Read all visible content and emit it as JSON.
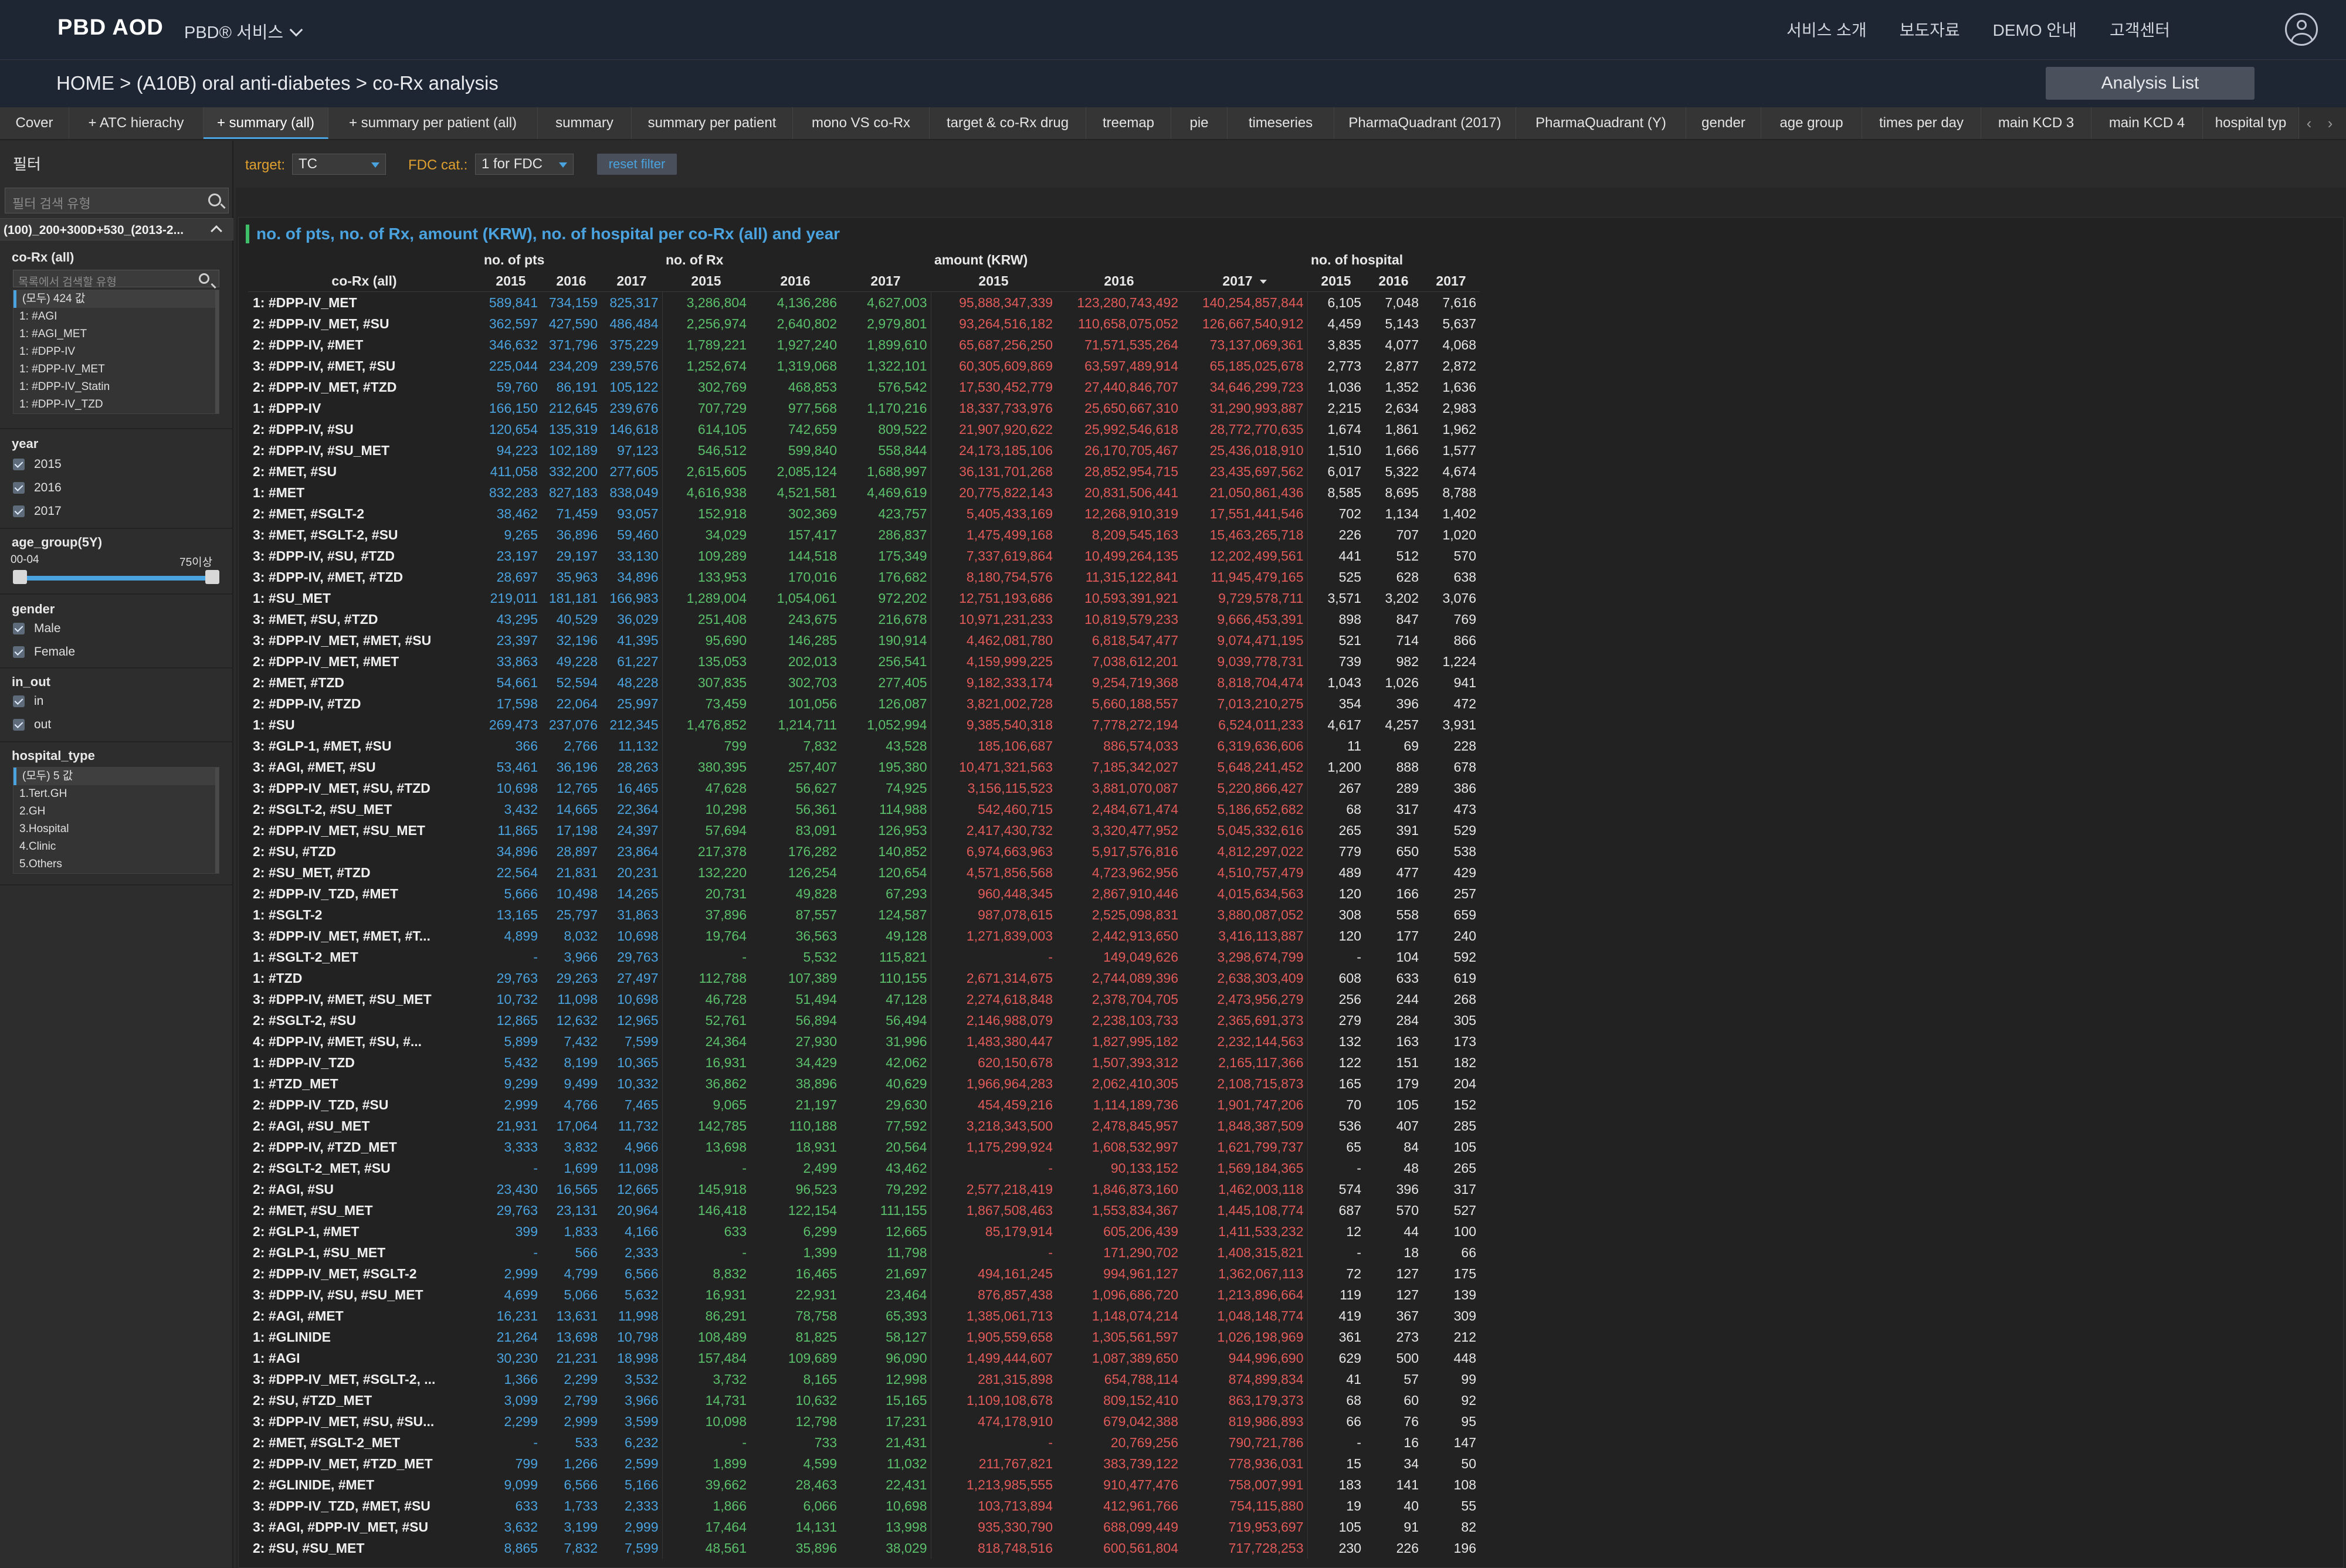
{
  "header": {
    "logo": "PBD AOD",
    "service_menu": "PBD® 서비스",
    "nav": [
      "서비스 소개",
      "보도자료",
      "DEMO 안내",
      "고객센터"
    ]
  },
  "breadcrumb": "HOME > (A10B) oral anti-diabetes > co-Rx analysis",
  "analysis_list_label": "Analysis List",
  "tabs": [
    "Cover",
    "+ ATC hierachy",
    "+ summary (all)",
    "+ summary per patient (all)",
    "summary",
    "summary per patient",
    "mono VS co-Rx",
    "target & co-Rx drug",
    "treemap",
    "pie",
    "timeseries",
    "PharmaQuadrant (2017)",
    "PharmaQuadrant (Y)",
    "gender",
    "age group",
    "times per day",
    "main KCD 3",
    "main KCD 4",
    "hospital typ"
  ],
  "active_tab": "+ summary (all)",
  "sidebar": {
    "title": "필터",
    "search_placeholder": "필터 검색 유형",
    "selection": "(100)_200+300D+530_(2013-2...",
    "corx": {
      "title": "co-Rx (all)",
      "search_placeholder": "목록에서 검색할 유형",
      "items": [
        "(모두) 424 값",
        "1: #AGI",
        "1: #AGI_MET",
        "1: #DPP-IV",
        "1: #DPP-IV_MET",
        "1: #DPP-IV_Statin",
        "1: #DPP-IV_TZD"
      ]
    },
    "year": {
      "title": "year",
      "items": [
        "2015",
        "2016",
        "2017"
      ]
    },
    "age_group": {
      "title": "age_group(5Y)",
      "min_label": "00-04",
      "max_label": "75이상"
    },
    "gender": {
      "title": "gender",
      "items": [
        "Male",
        "Female"
      ]
    },
    "in_out": {
      "title": "in_out",
      "items": [
        "in",
        "out"
      ]
    },
    "hospital_type": {
      "title": "hospital_type",
      "items": [
        "(모두) 5 값",
        "1.Tert.GH",
        "2.GH",
        "3.Hospital",
        "4.Clinic",
        "5.Others"
      ]
    }
  },
  "filters": {
    "target_label": "target:",
    "target_value": "TC",
    "fdc_label": "FDC cat.:",
    "fdc_value": "1 for FDC",
    "reset_label": "reset filter"
  },
  "panel_title": "no. of pts, no. of Rx, amount (KRW), no. of hospital per co-Rx (all) and year",
  "table": {
    "group_headers": [
      "no. of pts",
      "no. of Rx",
      "amount (KRW)",
      "no. of hospital"
    ],
    "row_header": "co-Rx (all)",
    "years": [
      "2015",
      "2016",
      "2017"
    ],
    "rows": [
      [
        "1: #DPP-IV_MET",
        "589,841",
        "734,159",
        "825,317",
        "3,286,804",
        "4,136,286",
        "4,627,003",
        "95,888,347,339",
        "123,280,743,492",
        "140,254,857,844",
        "6,105",
        "7,048",
        "7,616"
      ],
      [
        "2: #DPP-IV_MET, #SU",
        "362,597",
        "427,590",
        "486,484",
        "2,256,974",
        "2,640,802",
        "2,979,801",
        "93,264,516,182",
        "110,658,075,052",
        "126,667,540,912",
        "4,459",
        "5,143",
        "5,637"
      ],
      [
        "2: #DPP-IV, #MET",
        "346,632",
        "371,796",
        "375,229",
        "1,789,221",
        "1,927,240",
        "1,899,610",
        "65,687,256,250",
        "71,571,535,264",
        "73,137,069,361",
        "3,835",
        "4,077",
        "4,068"
      ],
      [
        "3: #DPP-IV, #MET, #SU",
        "225,044",
        "234,209",
        "239,576",
        "1,252,674",
        "1,319,068",
        "1,322,101",
        "60,305,609,869",
        "63,597,489,914",
        "65,185,025,678",
        "2,773",
        "2,877",
        "2,872"
      ],
      [
        "2: #DPP-IV_MET, #TZD",
        "59,760",
        "86,191",
        "105,122",
        "302,769",
        "468,853",
        "576,542",
        "17,530,452,779",
        "27,440,846,707",
        "34,646,299,723",
        "1,036",
        "1,352",
        "1,636"
      ],
      [
        "1: #DPP-IV",
        "166,150",
        "212,645",
        "239,676",
        "707,729",
        "977,568",
        "1,170,216",
        "18,337,733,976",
        "25,650,667,310",
        "31,290,993,887",
        "2,215",
        "2,634",
        "2,983"
      ],
      [
        "2: #DPP-IV, #SU",
        "120,654",
        "135,319",
        "146,618",
        "614,105",
        "742,659",
        "809,522",
        "21,907,920,622",
        "25,992,546,618",
        "28,772,770,635",
        "1,674",
        "1,861",
        "1,962"
      ],
      [
        "2: #DPP-IV, #SU_MET",
        "94,223",
        "102,189",
        "97,123",
        "546,512",
        "599,840",
        "558,844",
        "24,173,185,106",
        "26,170,705,467",
        "25,436,018,910",
        "1,510",
        "1,666",
        "1,577"
      ],
      [
        "2: #MET, #SU",
        "411,058",
        "332,200",
        "277,605",
        "2,615,605",
        "2,085,124",
        "1,688,997",
        "36,131,701,268",
        "28,852,954,715",
        "23,435,697,562",
        "6,017",
        "5,322",
        "4,674"
      ],
      [
        "1: #MET",
        "832,283",
        "827,183",
        "838,049",
        "4,616,938",
        "4,521,581",
        "4,469,619",
        "20,775,822,143",
        "20,831,506,441",
        "21,050,861,436",
        "8,585",
        "8,695",
        "8,788"
      ],
      [
        "2: #MET, #SGLT-2",
        "38,462",
        "71,459",
        "93,057",
        "152,918",
        "302,369",
        "423,757",
        "5,405,433,169",
        "12,268,910,319",
        "17,551,441,546",
        "702",
        "1,134",
        "1,402"
      ],
      [
        "3: #MET, #SGLT-2, #SU",
        "9,265",
        "36,896",
        "59,460",
        "34,029",
        "157,417",
        "286,837",
        "1,475,499,168",
        "8,209,545,163",
        "15,463,265,718",
        "226",
        "707",
        "1,020"
      ],
      [
        "3: #DPP-IV, #SU, #TZD",
        "23,197",
        "29,197",
        "33,130",
        "109,289",
        "144,518",
        "175,349",
        "7,337,619,864",
        "10,499,264,135",
        "12,202,499,561",
        "441",
        "512",
        "570"
      ],
      [
        "3: #DPP-IV, #MET, #TZD",
        "28,697",
        "35,963",
        "34,896",
        "133,953",
        "170,016",
        "176,682",
        "8,180,754,576",
        "11,315,122,841",
        "11,945,479,165",
        "525",
        "628",
        "638"
      ],
      [
        "1: #SU_MET",
        "219,011",
        "181,181",
        "166,983",
        "1,289,004",
        "1,054,061",
        "972,202",
        "12,751,193,686",
        "10,593,391,921",
        "9,729,578,711",
        "3,571",
        "3,202",
        "3,076"
      ],
      [
        "3: #MET, #SU, #TZD",
        "43,295",
        "40,529",
        "36,029",
        "251,408",
        "243,675",
        "216,678",
        "10,971,231,233",
        "10,819,579,233",
        "9,666,453,391",
        "898",
        "847",
        "769"
      ],
      [
        "3: #DPP-IV_MET, #MET, #SU",
        "23,397",
        "32,196",
        "41,395",
        "95,690",
        "146,285",
        "190,914",
        "4,462,081,780",
        "6,818,547,477",
        "9,074,471,195",
        "521",
        "714",
        "866"
      ],
      [
        "2: #DPP-IV_MET, #MET",
        "33,863",
        "49,228",
        "61,227",
        "135,053",
        "202,013",
        "256,541",
        "4,159,999,225",
        "7,038,612,201",
        "9,039,778,731",
        "739",
        "982",
        "1,224"
      ],
      [
        "2: #MET, #TZD",
        "54,661",
        "52,594",
        "48,228",
        "307,835",
        "302,703",
        "277,405",
        "9,182,333,174",
        "9,254,719,368",
        "8,818,704,474",
        "1,043",
        "1,026",
        "941"
      ],
      [
        "2: #DPP-IV, #TZD",
        "17,598",
        "22,064",
        "25,997",
        "73,459",
        "101,056",
        "126,087",
        "3,821,002,728",
        "5,660,188,557",
        "7,013,210,275",
        "354",
        "396",
        "472"
      ],
      [
        "1: #SU",
        "269,473",
        "237,076",
        "212,345",
        "1,476,852",
        "1,214,711",
        "1,052,994",
        "9,385,540,318",
        "7,778,272,194",
        "6,524,011,233",
        "4,617",
        "4,257",
        "3,931"
      ],
      [
        "3: #GLP-1, #MET, #SU",
        "366",
        "2,766",
        "11,132",
        "799",
        "7,832",
        "43,528",
        "185,106,687",
        "886,574,033",
        "6,319,636,606",
        "11",
        "69",
        "228"
      ],
      [
        "3: #AGI, #MET, #SU",
        "53,461",
        "36,196",
        "28,263",
        "380,395",
        "257,407",
        "195,380",
        "10,471,321,563",
        "7,185,342,027",
        "5,648,241,452",
        "1,200",
        "888",
        "678"
      ],
      [
        "3: #DPP-IV_MET, #SU, #TZD",
        "10,698",
        "12,765",
        "16,465",
        "47,628",
        "56,627",
        "74,925",
        "3,156,115,523",
        "3,881,070,087",
        "5,220,866,427",
        "267",
        "289",
        "386"
      ],
      [
        "2: #SGLT-2, #SU_MET",
        "3,432",
        "14,665",
        "22,364",
        "10,298",
        "56,361",
        "114,988",
        "542,460,715",
        "2,484,671,474",
        "5,186,652,682",
        "68",
        "317",
        "473"
      ],
      [
        "2: #DPP-IV_MET, #SU_MET",
        "11,865",
        "17,198",
        "24,397",
        "57,694",
        "83,091",
        "126,953",
        "2,417,430,732",
        "3,320,477,952",
        "5,045,332,616",
        "265",
        "391",
        "529"
      ],
      [
        "2: #SU, #TZD",
        "34,896",
        "28,897",
        "23,864",
        "217,378",
        "176,282",
        "140,852",
        "6,974,663,963",
        "5,917,576,816",
        "4,812,297,022",
        "779",
        "650",
        "538"
      ],
      [
        "2: #SU_MET, #TZD",
        "22,564",
        "21,831",
        "20,231",
        "132,220",
        "126,254",
        "120,654",
        "4,571,856,568",
        "4,723,962,956",
        "4,510,757,479",
        "489",
        "477",
        "429"
      ],
      [
        "2: #DPP-IV_TZD, #MET",
        "5,666",
        "10,498",
        "14,265",
        "20,731",
        "49,828",
        "67,293",
        "960,448,345",
        "2,867,910,446",
        "4,015,634,563",
        "120",
        "166",
        "257"
      ],
      [
        "1: #SGLT-2",
        "13,165",
        "25,797",
        "31,863",
        "37,896",
        "87,557",
        "124,587",
        "987,078,615",
        "2,525,098,831",
        "3,880,087,052",
        "308",
        "558",
        "659"
      ],
      [
        "3: #DPP-IV_MET, #MET, #T...",
        "4,899",
        "8,032",
        "10,698",
        "19,764",
        "36,563",
        "49,128",
        "1,271,839,003",
        "2,442,913,650",
        "3,416,113,887",
        "120",
        "177",
        "240"
      ],
      [
        "1: #SGLT-2_MET",
        "-",
        "3,966",
        "29,763",
        "-",
        "5,532",
        "115,821",
        "-",
        "149,049,626",
        "3,298,674,799",
        "-",
        "104",
        "592"
      ],
      [
        "1: #TZD",
        "29,763",
        "29,263",
        "27,497",
        "112,788",
        "107,389",
        "110,155",
        "2,671,314,675",
        "2,744,089,396",
        "2,638,303,409",
        "608",
        "633",
        "619"
      ],
      [
        "3: #DPP-IV, #MET, #SU_MET",
        "10,732",
        "11,098",
        "10,698",
        "46,728",
        "51,494",
        "47,128",
        "2,274,618,848",
        "2,378,704,705",
        "2,473,956,279",
        "256",
        "244",
        "268"
      ],
      [
        "2: #SGLT-2, #SU",
        "12,865",
        "12,632",
        "12,965",
        "52,761",
        "56,894",
        "56,494",
        "2,146,988,079",
        "2,238,103,733",
        "2,365,691,373",
        "279",
        "284",
        "305"
      ],
      [
        "4: #DPP-IV, #MET, #SU, #...",
        "5,899",
        "7,432",
        "7,599",
        "24,364",
        "27,930",
        "31,996",
        "1,483,380,447",
        "1,827,995,182",
        "2,232,144,563",
        "132",
        "163",
        "173"
      ],
      [
        "1: #DPP-IV_TZD",
        "5,432",
        "8,199",
        "10,365",
        "16,931",
        "34,429",
        "42,062",
        "620,150,678",
        "1,507,393,312",
        "2,165,117,366",
        "122",
        "151",
        "182"
      ],
      [
        "1: #TZD_MET",
        "9,299",
        "9,499",
        "10,332",
        "36,862",
        "38,896",
        "40,629",
        "1,966,964,283",
        "2,062,410,305",
        "2,108,715,873",
        "165",
        "179",
        "204"
      ],
      [
        "2: #DPP-IV_TZD, #SU",
        "2,999",
        "4,766",
        "7,465",
        "9,065",
        "21,197",
        "29,630",
        "454,459,216",
        "1,114,189,736",
        "1,901,747,206",
        "70",
        "105",
        "152"
      ],
      [
        "2: #AGI, #SU_MET",
        "21,931",
        "17,064",
        "11,732",
        "142,785",
        "110,188",
        "77,592",
        "3,218,343,500",
        "2,478,845,957",
        "1,848,387,509",
        "536",
        "407",
        "285"
      ],
      [
        "2: #DPP-IV, #TZD_MET",
        "3,333",
        "3,832",
        "4,966",
        "13,698",
        "18,931",
        "20,564",
        "1,175,299,924",
        "1,608,532,997",
        "1,621,799,737",
        "65",
        "84",
        "105"
      ],
      [
        "2: #SGLT-2_MET, #SU",
        "-",
        "1,699",
        "11,098",
        "-",
        "2,499",
        "43,462",
        "-",
        "90,133,152",
        "1,569,184,365",
        "-",
        "48",
        "265"
      ],
      [
        "2: #AGI, #SU",
        "23,430",
        "16,565",
        "12,665",
        "145,918",
        "96,523",
        "79,292",
        "2,577,218,419",
        "1,846,873,160",
        "1,462,003,118",
        "574",
        "396",
        "317"
      ],
      [
        "2: #MET, #SU_MET",
        "29,763",
        "23,131",
        "20,964",
        "146,418",
        "122,154",
        "111,155",
        "1,867,508,463",
        "1,553,834,367",
        "1,445,108,774",
        "687",
        "570",
        "527"
      ],
      [
        "2: #GLP-1, #MET",
        "399",
        "1,833",
        "4,166",
        "633",
        "6,299",
        "12,665",
        "85,179,914",
        "605,206,439",
        "1,411,533,232",
        "12",
        "44",
        "100"
      ],
      [
        "2: #GLP-1, #SU_MET",
        "-",
        "566",
        "2,333",
        "-",
        "1,399",
        "11,798",
        "-",
        "171,290,702",
        "1,408,315,821",
        "-",
        "18",
        "66"
      ],
      [
        "2: #DPP-IV_MET, #SGLT-2",
        "2,999",
        "4,799",
        "6,566",
        "8,832",
        "16,465",
        "21,697",
        "494,161,245",
        "994,961,127",
        "1,362,067,113",
        "72",
        "127",
        "175"
      ],
      [
        "3: #DPP-IV, #SU, #SU_MET",
        "4,699",
        "5,066",
        "5,632",
        "16,931",
        "22,931",
        "23,464",
        "876,857,438",
        "1,096,686,720",
        "1,213,896,664",
        "119",
        "127",
        "139"
      ],
      [
        "2: #AGI, #MET",
        "16,231",
        "13,631",
        "11,998",
        "86,291",
        "78,758",
        "65,393",
        "1,385,061,713",
        "1,148,074,214",
        "1,048,148,774",
        "419",
        "367",
        "309"
      ],
      [
        "1: #GLINIDE",
        "21,264",
        "13,698",
        "10,798",
        "108,489",
        "81,825",
        "58,127",
        "1,905,559,658",
        "1,305,561,597",
        "1,026,198,969",
        "361",
        "273",
        "212"
      ],
      [
        "1: #AGI",
        "30,230",
        "21,231",
        "18,998",
        "157,484",
        "109,689",
        "96,090",
        "1,499,444,607",
        "1,087,389,650",
        "944,996,690",
        "629",
        "500",
        "448"
      ],
      [
        "3: #DPP-IV_MET, #SGLT-2, ...",
        "1,366",
        "2,299",
        "3,532",
        "3,732",
        "8,165",
        "12,998",
        "281,315,898",
        "654,788,114",
        "874,899,834",
        "41",
        "57",
        "99"
      ],
      [
        "2: #SU, #TZD_MET",
        "3,099",
        "2,799",
        "3,966",
        "14,731",
        "10,632",
        "15,165",
        "1,109,108,678",
        "809,152,410",
        "863,179,373",
        "68",
        "60",
        "92"
      ],
      [
        "3: #DPP-IV_MET, #SU, #SU...",
        "2,299",
        "2,999",
        "3,599",
        "10,098",
        "12,798",
        "17,231",
        "474,178,910",
        "679,042,388",
        "819,986,893",
        "66",
        "76",
        "95"
      ],
      [
        "2: #MET, #SGLT-2_MET",
        "-",
        "533",
        "6,232",
        "-",
        "733",
        "21,431",
        "-",
        "20,769,256",
        "790,721,786",
        "-",
        "16",
        "147"
      ],
      [
        "2: #DPP-IV_MET, #TZD_MET",
        "799",
        "1,266",
        "2,599",
        "1,899",
        "4,599",
        "11,032",
        "211,767,821",
        "383,739,122",
        "778,936,031",
        "15",
        "34",
        "50"
      ],
      [
        "2: #GLINIDE, #MET",
        "9,099",
        "6,566",
        "5,166",
        "39,662",
        "28,463",
        "22,431",
        "1,213,985,555",
        "910,477,476",
        "758,007,991",
        "183",
        "141",
        "108"
      ],
      [
        "3: #DPP-IV_TZD, #MET, #SU",
        "633",
        "1,733",
        "2,333",
        "1,866",
        "6,066",
        "10,698",
        "103,713,894",
        "412,961,766",
        "754,115,880",
        "19",
        "40",
        "55"
      ],
      [
        "3: #AGI, #DPP-IV_MET, #SU",
        "3,632",
        "3,199",
        "2,999",
        "17,464",
        "14,131",
        "13,998",
        "935,330,790",
        "688,099,449",
        "719,953,697",
        "105",
        "91",
        "82"
      ],
      [
        "2: #SU, #SU_MET",
        "8,865",
        "7,832",
        "7,599",
        "48,561",
        "35,896",
        "38,029",
        "818,748,516",
        "600,561,804",
        "717,728,253",
        "230",
        "226",
        "196"
      ]
    ]
  },
  "colors": {
    "pts": "#4aa3df",
    "rx": "#5bc06b",
    "amount": "#e05a5a",
    "accent": "#4aa3df"
  }
}
